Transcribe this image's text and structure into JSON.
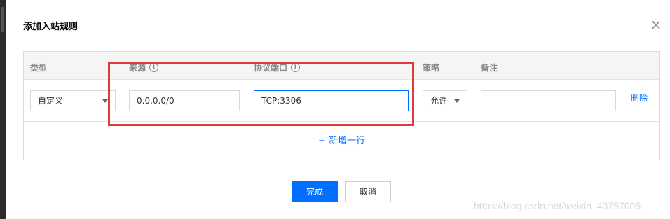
{
  "dialog": {
    "title": "添加入站规则",
    "close_icon": "close-icon"
  },
  "table": {
    "headers": {
      "type": "类型",
      "source": "来源",
      "protocol_port": "协议端口",
      "policy": "策略",
      "note": "备注"
    },
    "row": {
      "type_value": "自定义",
      "source_value": "0.0.0.0/0",
      "protocol_port_value": "TCP:3306",
      "policy_value": "允许",
      "note_value": "",
      "delete_label": "删除"
    },
    "add_row_label": "+ 新增一行"
  },
  "footer": {
    "confirm_label": "完成",
    "cancel_label": "取消"
  },
  "watermark": "https://blog.csdn.net/weixin_43757005",
  "colors": {
    "accent": "#006eff",
    "highlight": "#e0393e"
  }
}
